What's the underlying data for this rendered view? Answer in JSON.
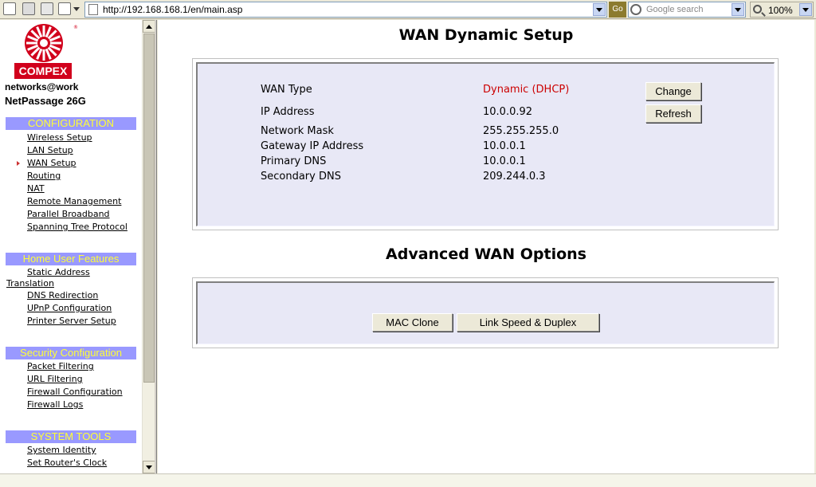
{
  "browser": {
    "url": "http://192.168.168.1/en/main.asp",
    "go_label": "Go",
    "search_placeholder": "Google search",
    "zoom": "100%"
  },
  "sidebar": {
    "brand": "COMPEX",
    "reg_mark": "®",
    "tagline": "networks@work",
    "product": "NetPassage 26G",
    "sections": [
      {
        "title": "CONFIGURATION",
        "items": [
          "Wireless Setup",
          "LAN Setup",
          "WAN Setup",
          "Routing",
          "NAT",
          "Remote Management",
          "Parallel Broadband",
          "Spanning Tree Protocol"
        ]
      },
      {
        "title": "Home User Features",
        "items": [
          "Static Address",
          "Translation",
          "DNS Redirection",
          "UPnP Configuration",
          "Printer Server Setup"
        ]
      },
      {
        "title": "Security Configuration",
        "items": [
          "Packet Filtering",
          "URL Filtering",
          "Firewall Configuration",
          "Firewall Logs"
        ]
      },
      {
        "title": "SYSTEM TOOLS",
        "items": [
          "System Identity",
          "Set Router's Clock"
        ]
      }
    ]
  },
  "main": {
    "wan_title": "WAN Dynamic Setup",
    "rows": [
      {
        "label": "WAN Type",
        "value": "Dynamic (DHCP)"
      },
      {
        "label": "IP Address",
        "value": "10.0.0.92"
      },
      {
        "label": "Network Mask",
        "value": "255.255.255.0"
      },
      {
        "label": "Gateway IP Address",
        "value": "10.0.0.1"
      },
      {
        "label": "Primary DNS",
        "value": "10.0.0.1"
      },
      {
        "label": "Secondary DNS",
        "value": "209.244.0.3"
      }
    ],
    "change_label": "Change",
    "refresh_label": "Refresh",
    "adv_title": "Advanced WAN Options",
    "mac_clone_label": "MAC Clone",
    "link_speed_label": "Link Speed & Duplex"
  },
  "colors": {
    "nav_header_bg": "#9999ff",
    "nav_header_text": "#ffff33",
    "brand_red": "#d1001c",
    "wan_type_value": "#cc0000",
    "panel_bg": "#e8e8f6"
  }
}
